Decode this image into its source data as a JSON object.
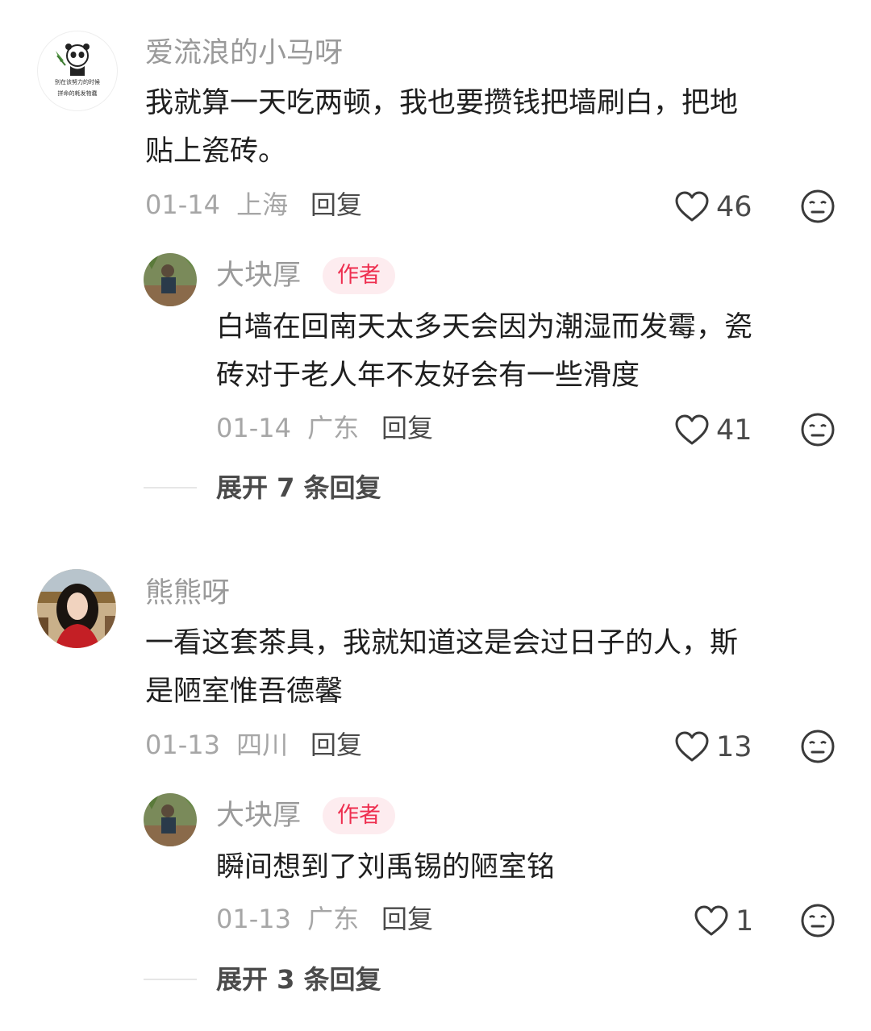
{
  "comments": [
    {
      "username": "爱流浪的小马呀",
      "avatar_text": [
        "别在该努力的时候",
        "拼命的耗发物蠢"
      ],
      "content_lines": [
        "我就算一天吃两顿，我也要攒钱把墙刷白，把地",
        "贴上瓷砖。"
      ],
      "date": "01-14",
      "location": "上海",
      "reply_label": "回复",
      "likes": "46",
      "replies": [
        {
          "username": "大块厚",
          "badge": "作者",
          "content_lines": [
            "白墙在回南天太多天会因为潮湿而发霉，瓷",
            "砖对于老人年不友好会有一些滑度"
          ],
          "date": "01-14",
          "location": "广东",
          "reply_label": "回复",
          "likes": "41"
        }
      ],
      "expand_label": "展开 7 条回复"
    },
    {
      "username": "熊熊呀",
      "content_lines": [
        "一看这套茶具，我就知道这是会过日子的人，斯",
        "是陋室惟吾德馨"
      ],
      "date": "01-13",
      "location": "四川",
      "reply_label": "回复",
      "likes": "13",
      "replies": [
        {
          "username": "大块厚",
          "badge": "作者",
          "content_lines": [
            "瞬间想到了刘禹锡的陋室铭"
          ],
          "date": "01-13",
          "location": "广东",
          "reply_label": "回复",
          "likes": "1"
        }
      ],
      "expand_label": "展开 3 条回复"
    }
  ],
  "icons": {
    "like": "heart-outline-icon",
    "dislike": "neutral-face-icon"
  },
  "colors": {
    "badge_text": "#ee2e4f",
    "badge_bg": "#fdecef",
    "meta_gray": "#a6a6a6"
  }
}
